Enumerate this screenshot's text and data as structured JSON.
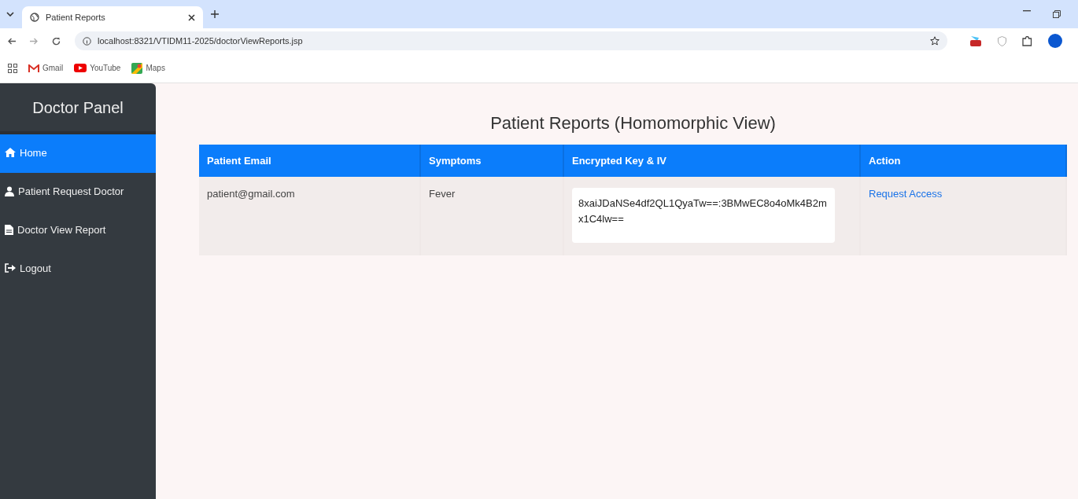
{
  "browser": {
    "tab": {
      "title": "Patient Reports"
    },
    "address": "localhost:8321/VTIDM11-2025/doctorViewReports.jsp",
    "bookmarks": [
      {
        "label": "Gmail",
        "kind": "gmail"
      },
      {
        "label": "YouTube",
        "kind": "youtube"
      },
      {
        "label": "Maps",
        "kind": "maps"
      }
    ]
  },
  "sidebar": {
    "title": "Doctor Panel",
    "items": [
      {
        "label": "Home",
        "kind": "home",
        "selected": true
      },
      {
        "label": "Patient Request Doctor",
        "kind": "user",
        "selected": false
      },
      {
        "label": "Doctor View Report",
        "kind": "file",
        "selected": false
      },
      {
        "label": "Logout",
        "kind": "logout",
        "selected": false
      }
    ]
  },
  "page": {
    "title": "Patient Reports (Homomorphic View)"
  },
  "table": {
    "columns": [
      "Patient Email",
      "Symptoms",
      "Encrypted Key & IV",
      "Action"
    ],
    "rows": [
      {
        "email": "patient@gmail.com",
        "symptoms": "Fever",
        "key": "8xaiJDaNSe4df2QL1QyaTw==:3BMwEC8o4oMk4B2mx1C4lw==",
        "action": "Request Access"
      }
    ]
  }
}
